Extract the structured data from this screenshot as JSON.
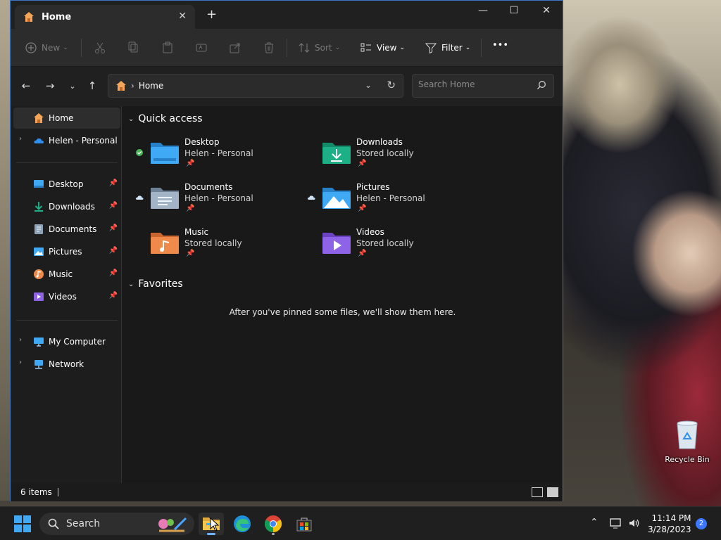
{
  "window": {
    "tab_title": "Home",
    "new_tab_glyph": "+",
    "close_glyph": "✕",
    "minimize_glyph": "—",
    "maximize_glyph": "☐"
  },
  "toolbar": {
    "new_label": "New",
    "sort_label": "Sort",
    "view_label": "View",
    "filter_label": "Filter",
    "more_label": "•••"
  },
  "navbar": {
    "address_text": "Home",
    "address_separator": "›",
    "search_placeholder": "Search Home"
  },
  "sidebar": {
    "items": [
      {
        "label": "Home"
      },
      {
        "label": "Helen - Personal"
      },
      {
        "label": "Desktop"
      },
      {
        "label": "Downloads"
      },
      {
        "label": "Documents"
      },
      {
        "label": "Pictures"
      },
      {
        "label": "Music"
      },
      {
        "label": "Videos"
      },
      {
        "label": "My Computer"
      },
      {
        "label": "Network"
      }
    ]
  },
  "content": {
    "quick_access_title": "Quick access",
    "favorites_title": "Favorites",
    "empty_message": "After you've pinned some files, we'll show them here.",
    "tiles": [
      {
        "name": "Desktop",
        "sub": "Helen - Personal"
      },
      {
        "name": "Downloads",
        "sub": "Stored locally"
      },
      {
        "name": "Documents",
        "sub": "Helen - Personal"
      },
      {
        "name": "Pictures",
        "sub": "Helen - Personal"
      },
      {
        "name": "Music",
        "sub": "Stored locally"
      },
      {
        "name": "Videos",
        "sub": "Stored locally"
      }
    ]
  },
  "status": {
    "item_count": "6 items"
  },
  "desktop": {
    "recycle_label": "Recycle Bin"
  },
  "taskbar": {
    "search_label": "Search",
    "time": "11:14 PM",
    "date": "3/28/2023",
    "notification_count": "2"
  },
  "colors": {
    "accent": "#3f74c2",
    "folder_blue": "#3fa9f5",
    "download_teal": "#1db087",
    "music_orange": "#f08a4b",
    "video_purple": "#8f63e8"
  }
}
